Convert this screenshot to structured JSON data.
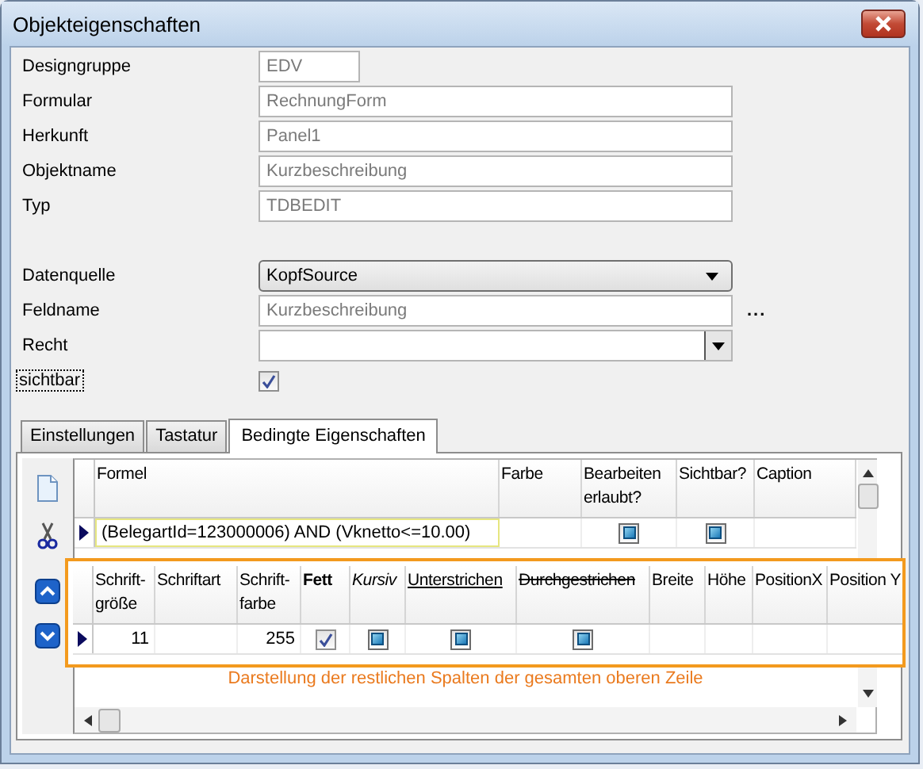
{
  "window": {
    "title": "Objekteigenschaften"
  },
  "object_fields": [
    {
      "label": "Designgruppe",
      "kind": "short",
      "value": "EDV"
    },
    {
      "label": "Formular",
      "kind": "text",
      "value": "RechnungForm"
    },
    {
      "label": "Herkunft",
      "kind": "text",
      "value": "Panel1"
    },
    {
      "label": "Objektname",
      "kind": "text",
      "value": "Kurzbeschreibung"
    },
    {
      "label": "Typ",
      "kind": "text",
      "value": "TDBEDIT"
    }
  ],
  "data_fields": [
    {
      "label": "Datenquelle",
      "kind": "select",
      "value": "KopfSource"
    },
    {
      "label": "Feldname",
      "kind": "browse",
      "value": "Kurzbeschreibung",
      "button": "..."
    },
    {
      "label": "Recht",
      "kind": "combo"
    },
    {
      "label": "sichtbar",
      "kind": "checkbox",
      "checked": true
    }
  ],
  "tabs": [
    {
      "label": "Einstellungen",
      "selected": false
    },
    {
      "label": "Tastatur",
      "selected": false
    },
    {
      "label": "Bedingte Eigenschaften",
      "selected": true
    }
  ],
  "conditions_grid": {
    "columns": [
      {
        "label": "Formel"
      },
      {
        "label": "Farbe"
      },
      {
        "label": "Bearbeiten erlaubt?"
      },
      {
        "label": "Sichtbar?"
      },
      {
        "label": "Caption"
      }
    ],
    "rows": [
      {
        "selected": true,
        "cells": [
          {
            "kind": "text",
            "text": "(BelegartId=123000006) AND (Vknetto<=10.00)"
          },
          {
            "kind": "empty"
          },
          {
            "kind": "square",
            "checked": true
          },
          {
            "kind": "square",
            "checked": true
          },
          {
            "kind": "empty"
          }
        ]
      }
    ]
  },
  "font_grid": {
    "columns": [
      {
        "label": "Schrift-größe",
        "kind": "plain"
      },
      {
        "label": "Schriftart",
        "kind": "plain"
      },
      {
        "label": "Schrift-farbe",
        "kind": "plain"
      },
      {
        "label": "Fett",
        "kind": "bold"
      },
      {
        "label": "Kursiv",
        "kind": "italic"
      },
      {
        "label": "Unterstrichen",
        "kind": "underline"
      },
      {
        "label": "Durchgestrichen",
        "kind": "strike"
      },
      {
        "label": "Breite",
        "kind": "plain"
      },
      {
        "label": "Höhe",
        "kind": "plain"
      },
      {
        "label": "PositionX",
        "kind": "plain"
      },
      {
        "label": "Position Y",
        "kind": "plain"
      }
    ],
    "rows": [
      {
        "selected": true,
        "cells": [
          {
            "kind": "number",
            "text": "11"
          },
          {
            "kind": "empty"
          },
          {
            "kind": "number",
            "text": "255"
          },
          {
            "kind": "check",
            "checked": true
          },
          {
            "kind": "square",
            "checked": true
          },
          {
            "kind": "square",
            "checked": true
          },
          {
            "kind": "square",
            "checked": true
          },
          {
            "kind": "empty"
          },
          {
            "kind": "empty"
          },
          {
            "kind": "empty"
          },
          {
            "kind": "empty"
          }
        ]
      }
    ]
  },
  "note": "Darstellung der restlichen Spalten der gesamten oberen Zeile"
}
